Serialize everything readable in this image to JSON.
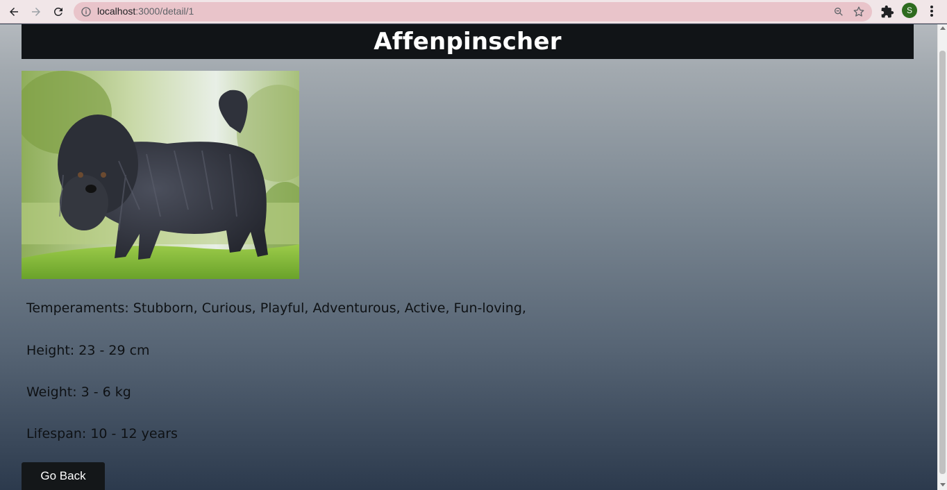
{
  "browser": {
    "url_host": "localhost",
    "url_rest": ":3000/detail/1",
    "profile_initial": "S"
  },
  "page": {
    "title": "Affenpinscher",
    "image_alt": "Affenpinscher",
    "details": [
      "Temperaments: Stubborn, Curious, Playful, Adventurous, Active, Fun-loving,",
      "Height: 23 - 29 cm",
      "Weight: 3 - 6 kg",
      "Lifespan: 10 - 12 years"
    ],
    "back_button_label": "Go Back"
  },
  "colors": {
    "header_bg": "#111417",
    "button_bg": "#141719",
    "omnibox_bg": "#e9c4ca",
    "avatar_bg": "#2e6b1f"
  }
}
